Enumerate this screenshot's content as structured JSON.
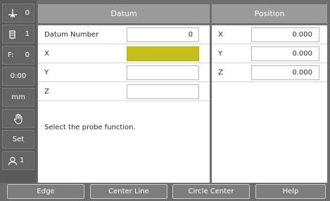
{
  "sidebar": {
    "axis_value": "0",
    "tool_value": "1",
    "feed_label": "F:",
    "feed_value": "0",
    "timer": "0:00",
    "units": "mm",
    "set_label": "Set",
    "user_value": "1"
  },
  "datum": {
    "header": "Datum",
    "rows": [
      {
        "label": "Datum Number",
        "value": "0"
      },
      {
        "label": "X",
        "value": ""
      },
      {
        "label": "Y",
        "value": ""
      },
      {
        "label": "Z",
        "value": ""
      }
    ],
    "message": "Select the probe function."
  },
  "position": {
    "header": "Position",
    "rows": [
      {
        "label": "X",
        "value": "0.000"
      },
      {
        "label": "Y",
        "value": "0.000"
      },
      {
        "label": "Z",
        "value": "0.000"
      }
    ]
  },
  "softkeys": [
    "Edge",
    "Center Line",
    "Circle Center",
    "Help"
  ],
  "colors": {
    "active_field": "#c4bf1c",
    "header": "#9a9a9a",
    "background": "#6e6e6e"
  }
}
